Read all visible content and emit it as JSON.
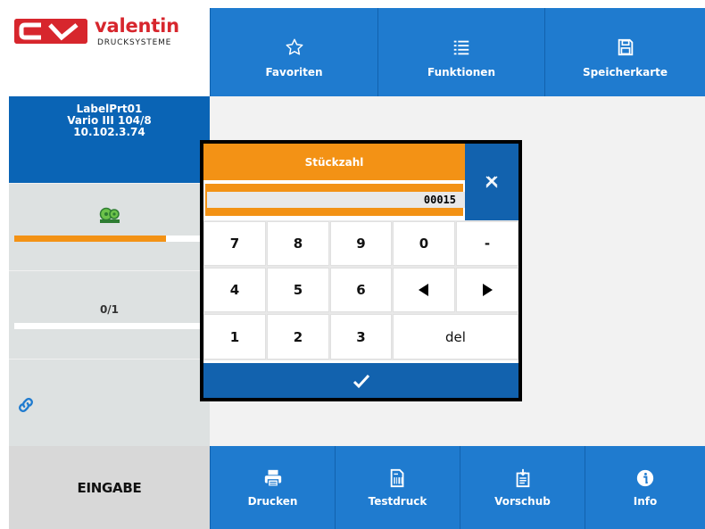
{
  "brand": {
    "name": "valentin",
    "subtitle": "DRUCKSYSTEME",
    "colors": {
      "red": "#d7262d",
      "blue": "#1f7bcf",
      "dark_blue": "#1262ae",
      "orange": "#f39215"
    }
  },
  "top_nav": [
    {
      "label": "Favoriten",
      "icon": "star-icon"
    },
    {
      "label": "Funktionen",
      "icon": "list-icon"
    },
    {
      "label": "Speicherkarte",
      "icon": "save-icon"
    }
  ],
  "device": {
    "name": "LabelPrt01",
    "model": "Vario III 104/8",
    "ip": "10.102.3.74"
  },
  "status": {
    "ribbon_icon": "ribbon-roll-icon",
    "ribbon_level": 0.8,
    "counter_text": "0/1",
    "counter_progress": 0.0,
    "link_icon": "link-icon"
  },
  "mode_label": "EINGABE",
  "dialog": {
    "title": "Stückzahl",
    "value": "00015",
    "close_icon": "close-icon",
    "keys": {
      "k7": "7",
      "k8": "8",
      "k9": "9",
      "k0": "0",
      "minus": "-",
      "k4": "4",
      "k5": "5",
      "k6": "6",
      "left": "◀",
      "right": "▶",
      "k1": "1",
      "k2": "2",
      "k3": "3",
      "del": "del"
    },
    "confirm_icon": "check-icon"
  },
  "bottom_nav": [
    {
      "label": "Drucken",
      "icon": "printer-icon"
    },
    {
      "label": "Testdruck",
      "icon": "test-print-icon"
    },
    {
      "label": "Vorschub",
      "icon": "feed-icon"
    },
    {
      "label": "Info",
      "icon": "info-icon"
    }
  ]
}
